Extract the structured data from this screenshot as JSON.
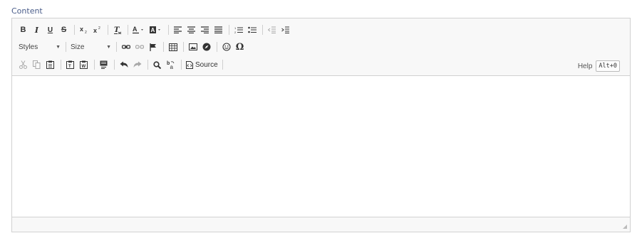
{
  "field": {
    "label": "Content"
  },
  "toolbar": {
    "styles_label": "Styles",
    "size_label": "Size",
    "source_label": "Source",
    "help_label": "Help",
    "help_shortcut": "Alt+0",
    "bold_glyph": "B",
    "italic_glyph": "I",
    "underline_glyph": "U",
    "strike_glyph": "S",
    "omega_glyph": "Ω"
  },
  "colors": {
    "label": "#4a5d8a",
    "border": "#d1d1d1",
    "toolbar_bg": "#f8f8f8",
    "icon": "#333333"
  }
}
